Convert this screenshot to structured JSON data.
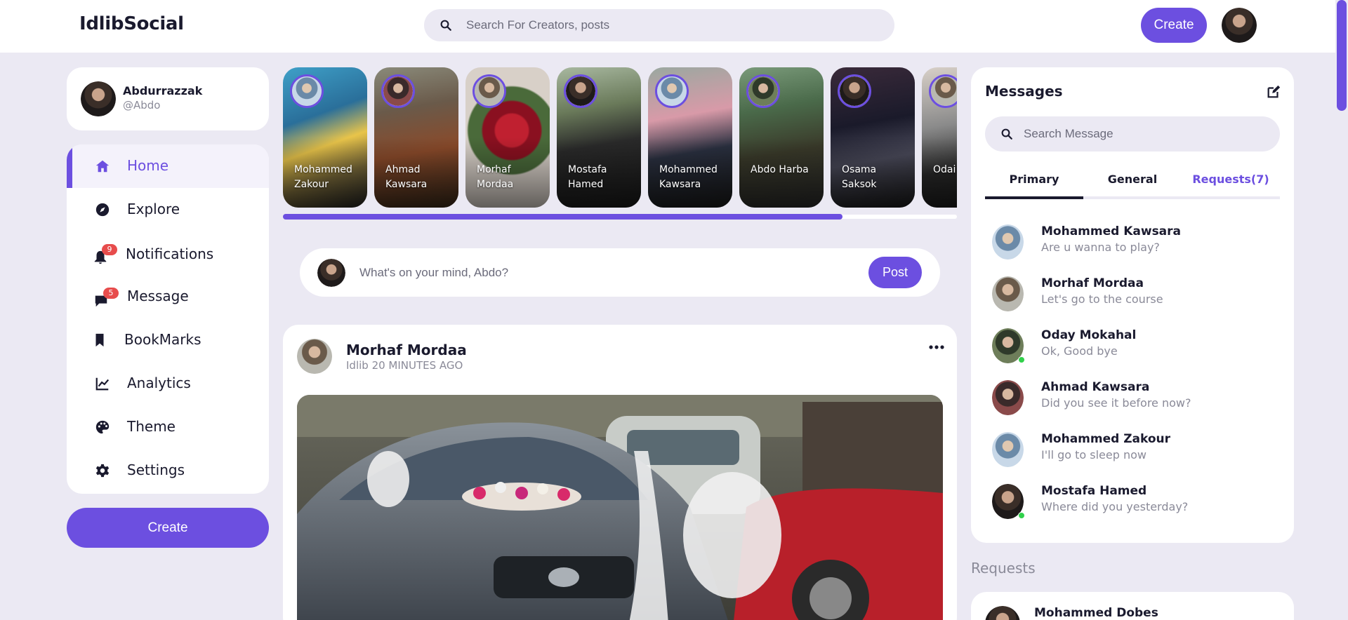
{
  "navbar": {
    "logo": "IdlibSocial",
    "search_placeholder": "Search For Creators, posts",
    "create_label": "Create"
  },
  "profile": {
    "name": "Abdurrazzak",
    "handle": "@Abdo"
  },
  "menu": {
    "items": [
      {
        "label": "Home",
        "icon": "home-icon"
      },
      {
        "label": "Explore",
        "icon": "compass-icon"
      },
      {
        "label": "Notifications",
        "icon": "bell-icon",
        "badge": "9"
      },
      {
        "label": "Message",
        "icon": "chat-icon",
        "badge": "5"
      },
      {
        "label": "BookMarks",
        "icon": "bookmark-icon"
      },
      {
        "label": "Analytics",
        "icon": "chart-line-icon"
      },
      {
        "label": "Theme",
        "icon": "palette-icon"
      },
      {
        "label": "Settings",
        "icon": "gear-icon"
      }
    ],
    "create_label": "Create"
  },
  "stories": {
    "items": [
      {
        "name": "Mohammed Zakour"
      },
      {
        "name": "Ahmad Kawsara"
      },
      {
        "name": "Morhaf Mordaa"
      },
      {
        "name": "Mostafa Hamed"
      },
      {
        "name": "Mohammed Kawsara"
      },
      {
        "name": "Abdo Harba"
      },
      {
        "name": "Osama Saksok"
      },
      {
        "name": "Odai Mok..."
      }
    ],
    "scroll_progress": 0.83
  },
  "composer": {
    "placeholder": "What's on your mind, Abdo?",
    "post_label": "Post"
  },
  "feed": {
    "author": "Morhaf Mordaa",
    "meta": "Idlib 20 MINUTES AGO"
  },
  "messages": {
    "title": "Messages",
    "search_placeholder": "Search Message",
    "tabs": [
      {
        "label": "Primary"
      },
      {
        "label": "General"
      },
      {
        "label": "Requests(7)"
      }
    ],
    "items": [
      {
        "name": "Mohammed Kawsara",
        "text": "Are u wanna to play?",
        "online": false
      },
      {
        "name": "Morhaf Mordaa",
        "text": "Let's go to the course",
        "online": false
      },
      {
        "name": "Oday Mokahal",
        "text": "Ok, Good bye",
        "online": true
      },
      {
        "name": "Ahmad Kawsara",
        "text": "Did you see it before now?",
        "online": false
      },
      {
        "name": "Mohammed Zakour",
        "text": "I'll go to sleep now",
        "online": false
      },
      {
        "name": "Mostafa Hamed",
        "text": "Where did you yesterday?",
        "online": true
      }
    ]
  },
  "requests": {
    "title": "Requests",
    "first_name": "Mohammed Dobes"
  },
  "colors": {
    "accent": "#6c4fe0",
    "background": "#ebe9f3",
    "badge": "#e74c4c",
    "online": "#31d14b"
  }
}
